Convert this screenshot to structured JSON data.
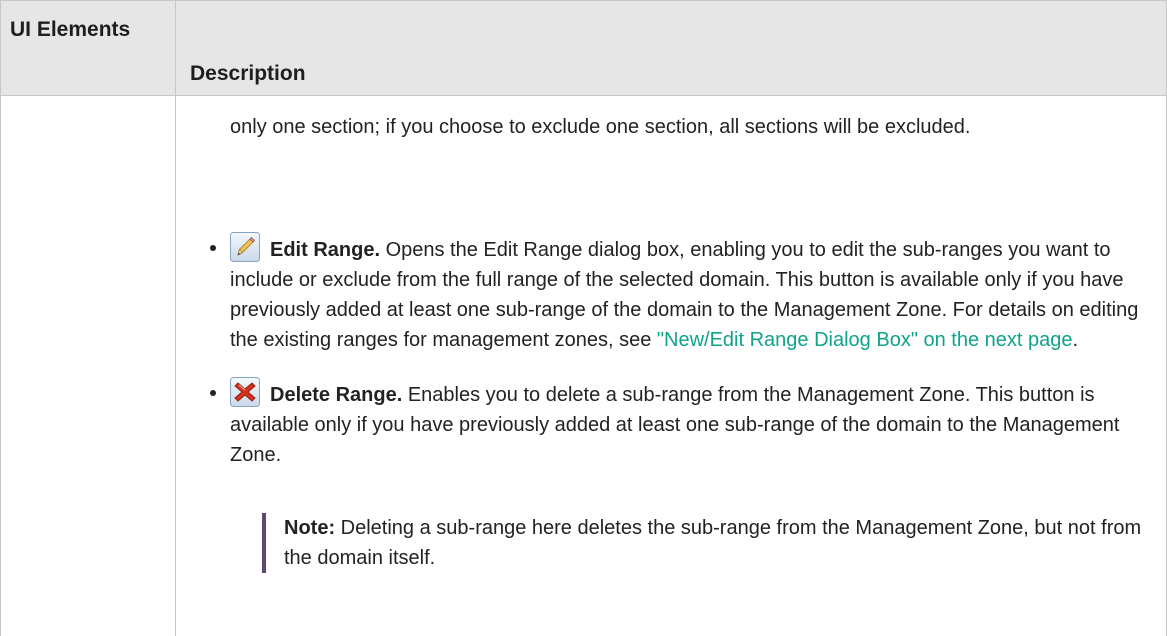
{
  "table": {
    "columns": [
      "UI Elements",
      "Description"
    ],
    "header_ui": "UI Elements",
    "header_desc": "Description"
  },
  "description": {
    "intro": "only one section; if you choose to exclude one section, all sections will be excluded.",
    "items": [
      {
        "icon": "pencil-edit-icon",
        "term": "Edit Range.",
        "text_before_link": " Opens the Edit Range dialog box, enabling you to edit the sub-ranges you want to include or exclude from the full range of the selected domain. This button is available only if you have previously added at least one sub-range of the domain to the Management Zone. For details on editing the existing ranges for management zones, see ",
        "link": "\"New/Edit Range Dialog Box\" on the next page",
        "text_after_link": "."
      },
      {
        "icon": "red-x-delete-icon",
        "term": "Delete Range.",
        "text": " Enables you to delete a sub-range from the Management Zone. This button is available only if you have previously added at least one sub-range of the domain to the Management Zone."
      }
    ],
    "note": {
      "label": "Note:",
      "text": "  Deleting a sub-range here deletes the sub-range from the Management Zone, but not from the domain itself."
    }
  },
  "colors": {
    "header_bg": "#e6e6e6",
    "link": "#0fa38a",
    "note_bar": "#5c4a75",
    "delete_icon": "#d9301c"
  }
}
